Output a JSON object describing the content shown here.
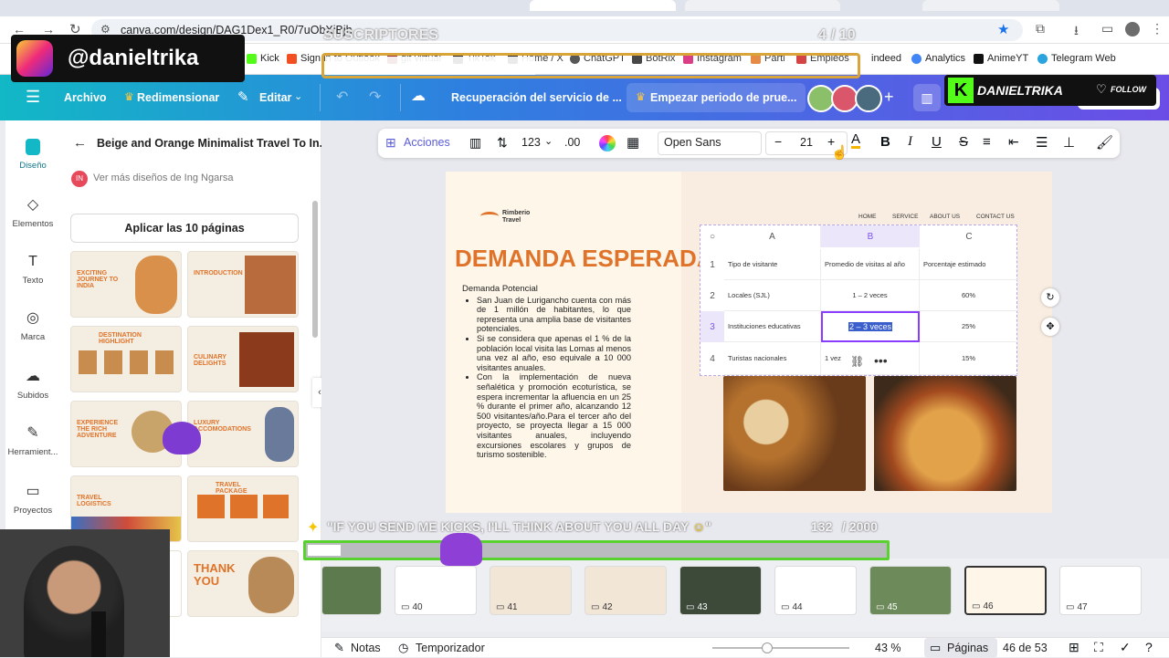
{
  "browser": {
    "url": "canva.com/design/DAG1Dex1_R0/7uObXiBjh",
    "bookmarks": [
      "Kick",
      "Sign in to Outlook",
      "git virtual",
      "TikTok",
      "Home / X",
      "ChatGPT",
      "BotRix",
      "Instagram",
      "Parti",
      "Empleos",
      "indeed",
      "Analytics",
      "AnimeYT",
      "Telegram Web"
    ]
  },
  "overlay": {
    "instagram_handle": "@danieltrika",
    "kick_handle": "DANIELTRIKA",
    "follow_label": "FOLLOW",
    "subs_label": "SUSCRIPTORES",
    "subs_count": "4",
    "subs_goal": "/ 10",
    "kicks_message": "\"IF YOU SEND ME KICKS, I'LL THINK ABOUT YOU ALL DAY",
    "kicks_count": "132",
    "kicks_goal": "/ 2000"
  },
  "header": {
    "menu": "Archivo",
    "resize": "Redimensionar",
    "edit": "Editar",
    "title": "Recuperación del servicio de ...",
    "trial": "Empezar periodo de prue..."
  },
  "rail": [
    "Diseño",
    "Elementos",
    "Texto",
    "Marca",
    "Subidos",
    "Herramient...",
    "Proyectos"
  ],
  "panel": {
    "title": "Beige and Orange Minimalist Travel To In...",
    "author": "Ver más diseños de Ing Ngarsa",
    "apply": "Aplicar las 10 páginas",
    "thumbs": [
      "EXCITING JOURNEY TO INDIA",
      "INTRODUCTION",
      "DESTINATION HIGHLIGHT",
      "CULINARY DELIGHTS",
      "EXPERIENCE THE RICH ADVENTURE",
      "LUXURY ACCOMODATIONS",
      "TRAVEL LOGISTICS",
      "TRAVEL PACKAGE",
      "",
      "THANK YOU"
    ]
  },
  "toolbar": {
    "actions": "Acciones",
    "number_format": "123",
    "decimals": ".00",
    "font": "Open Sans",
    "font_size": "21"
  },
  "slide": {
    "brand": "Rimberio Travel",
    "nav": [
      "HOME",
      "SERVICE",
      "ABOUT US",
      "CONTACT US"
    ],
    "title": "DEMANDA ESPERADA",
    "subtitle": "Demanda Potencial",
    "bullets": [
      "San Juan de Lurigancho cuenta con más de 1 millón de habitantes, lo que representa una amplia base de visitantes potenciales.",
      "Si se considera que apenas el 1 % de la población local visita las Lomas al menos una vez al año, eso equivale a 10 000 visitantes anuales.",
      "Con la implementación de nueva señalética y promoción ecoturística, se espera incrementar la afluencia en un 25 % durante el primer año, alcanzando 12 500 visitantes/año.Para el tercer año del proyecto, se proyecta llegar a 15 000 visitantes anuales, incluyendo excursiones escolares y grupos de turismo sostenible."
    ],
    "table": {
      "columns": [
        "A",
        "B",
        "C"
      ],
      "rows": [
        [
          "1",
          "Tipo de visitante",
          "Promedio de visitas al año",
          "Porcentaje estimado"
        ],
        [
          "2",
          "Locales (SJL)",
          "1 – 2 veces",
          "60%"
        ],
        [
          "3",
          "Instituciones educativas",
          "2 – 3 veces",
          "25%"
        ],
        [
          "4",
          "Turistas nacionales",
          "1 vez",
          "15%"
        ]
      ]
    }
  },
  "filmstrip": [
    "40",
    "41",
    "42",
    "43",
    "44",
    "45",
    "46",
    "47"
  ],
  "bottom": {
    "notes": "Notas",
    "timer": "Temporizador",
    "zoom": "43 %",
    "pages": "Páginas",
    "page_count": "46 de 53"
  }
}
